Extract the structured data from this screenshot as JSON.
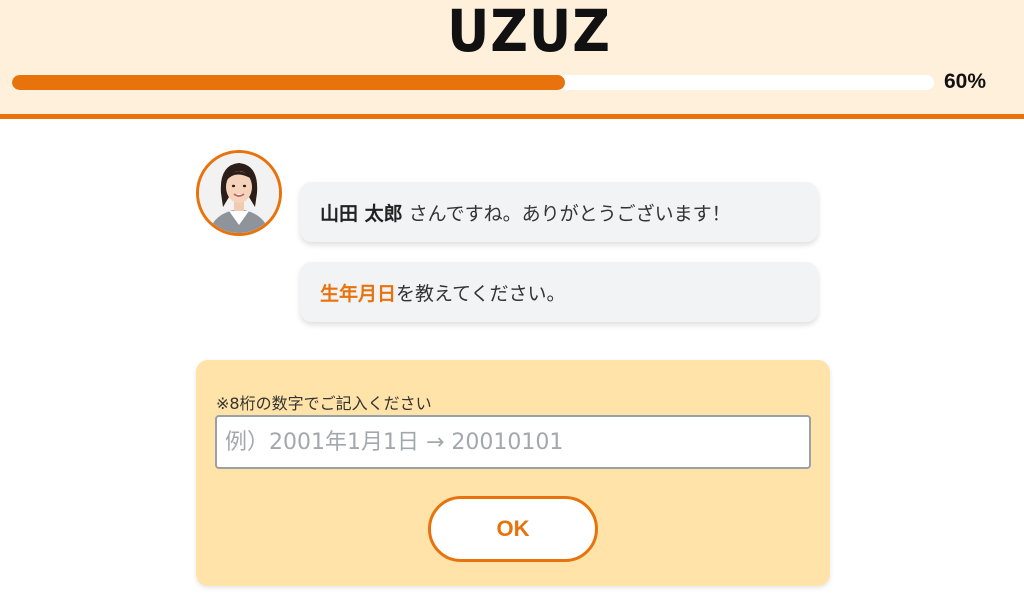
{
  "header": {
    "logo_text": "UZUZ",
    "progress_fraction": 0.6,
    "progress_label": "60%"
  },
  "chat": {
    "messages": [
      {
        "name": "山田 太郎",
        "text": "さんですね。ありがとうございます！"
      },
      {
        "highlight": "生年月日",
        "text": "を教えてください。"
      }
    ]
  },
  "form": {
    "note": "※8桁の数字でご記入ください",
    "birthdate_input": {
      "value": "",
      "placeholder": "例）2001年1月1日 → 20010101"
    },
    "ok_label": "OK"
  },
  "colors": {
    "accent": "#e8730c",
    "header_bg": "#fff0db",
    "form_bg": "#ffe3a8",
    "bubble_bg": "#f2f3f5"
  },
  "icons": {
    "avatar": "assistant-avatar-photo"
  }
}
